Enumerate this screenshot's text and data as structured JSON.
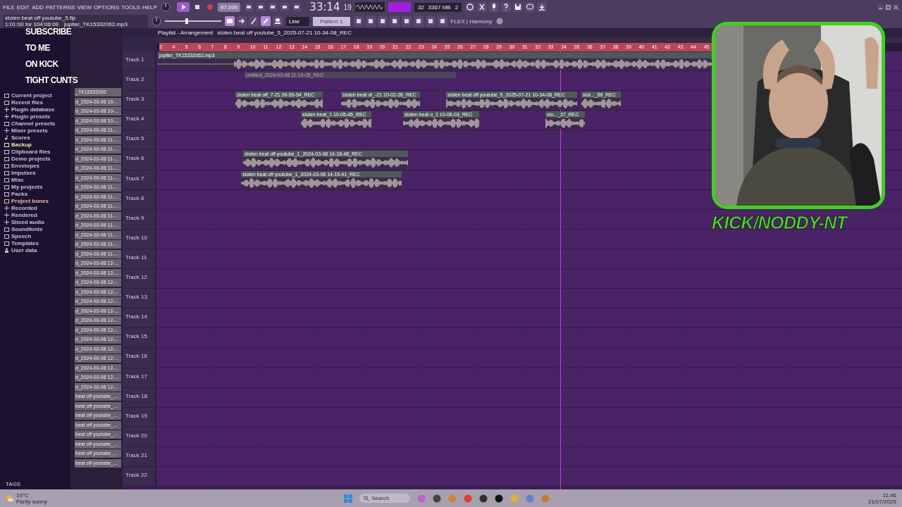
{
  "menu": [
    "FILE",
    "EDIT",
    "ADD",
    "PATTERNS",
    "VIEW",
    "OPTIONS",
    "TOOLS",
    "HELP"
  ],
  "project": {
    "file": "stolen beat off youtube_5.flp",
    "position": "1:01:00 for 104:06:09",
    "sample": "jupiter_TK15332062.mp3"
  },
  "volume": {
    "level": 0.38
  },
  "tempo": "97.000",
  "clock": {
    "time": "33:14",
    "ticks": "19"
  },
  "cpu": {
    "polyphony": "32",
    "memory": "3367 MB",
    "count": "2"
  },
  "snap": "Line",
  "pattern": "Pattern 1",
  "hint": "FLEX | Harmony",
  "browser": {
    "items": [
      {
        "label": "Current project",
        "kind": "folder"
      },
      {
        "label": "Recent files",
        "kind": "folder"
      },
      {
        "label": "Plugin database",
        "kind": "plugin"
      },
      {
        "label": "Plugin presets",
        "kind": "plugin"
      },
      {
        "label": "Channel presets",
        "kind": "folder"
      },
      {
        "label": "Mixer presets",
        "kind": "plugin"
      },
      {
        "label": "Scores",
        "kind": "note"
      },
      {
        "label": "Backup",
        "kind": "highlight"
      },
      {
        "label": "Clipboard files",
        "kind": "folder"
      },
      {
        "label": "Demo projects",
        "kind": "folder"
      },
      {
        "label": "Envelopes",
        "kind": "folder"
      },
      {
        "label": "Impulses",
        "kind": "folder"
      },
      {
        "label": "Misc",
        "kind": "folder"
      },
      {
        "label": "My projects",
        "kind": "folder"
      },
      {
        "label": "Packs",
        "kind": "folder"
      },
      {
        "label": "Project bones",
        "kind": "bones"
      },
      {
        "label": "Recorded",
        "kind": "plugin"
      },
      {
        "label": "Rendered",
        "kind": "plugin"
      },
      {
        "label": "Sliced audio",
        "kind": "plugin"
      },
      {
        "label": "Soundfonts",
        "kind": "folder"
      },
      {
        "label": "Speech",
        "kind": "folder"
      },
      {
        "label": "Templates",
        "kind": "folder"
      },
      {
        "label": "User data",
        "kind": "user"
      }
    ],
    "tags": "TAGS"
  },
  "rack": [
    "_TK15332062",
    "d_2024-03-08 10-...",
    "d_2024-03-08 10-...",
    "d_2024-03-08 10-...",
    "d_2024-03-08 11-...",
    "d_2024-03-08 11-...",
    "d_2024-03-08 11-...",
    "d_2024-03-08 11-...",
    "d_2024-03-08 11-...",
    "d_2024-03-08 11-...",
    "d_2024-03-08 11-...",
    "d_2024-03-08 11-...",
    "d_2024-03-08 11-...",
    "d_2024-03-08 11-...",
    "d_2024-03-08 11-...",
    "d_2024-03-08 11-...",
    "d_2024-03-08 11-...",
    "d_2024-03-08 11-...",
    "d_2024-03-08 12-...",
    "d_2024-03-08 12-...",
    "d_2024-03-08 12-...",
    "d_2024-03-08 12-...",
    "d_2024-03-08 12-...",
    "d_2024-03-08 12-...",
    "d_2024-03-08 12-...",
    "d_2024-03-08 12-...",
    "d_2024-03-08 12-...",
    "d_2024-03-08 12-...",
    "d_2024-03-08 12-...",
    "d_2024-03-08 12-...",
    "d_2024-03-08 12-...",
    "d_2024-03-08 12-...",
    "beat off youtube_...",
    "beat off youtube_...",
    "beat off youtube_...",
    "beat off youtube_...",
    "beat off youtube_...",
    "beat off youtube_...",
    "beat off youtube_...",
    "beat off youtube_..."
  ],
  "playlist": {
    "title": "Playlist - Arrangement",
    "path": "stolen beat off youtube_5_2025-07-21 10-34-08_REC",
    "ruler": [
      "3",
      "4",
      "5",
      "6",
      "7",
      "8",
      "9",
      "10",
      "11",
      "12",
      "13",
      "14",
      "15",
      "16",
      "17",
      "18",
      "19",
      "20",
      "21",
      "22",
      "23",
      "24",
      "25",
      "26",
      "27",
      "28",
      "29",
      "30",
      "31",
      "32",
      "33",
      "34",
      "35",
      "36",
      "37",
      "38",
      "39",
      "40",
      "41",
      "42",
      "43",
      "44",
      "45"
    ],
    "tracks": [
      {
        "name": "Track 1",
        "clips": [
          {
            "label": "jupiter_TK15332062.mp3",
            "kind": "audio"
          }
        ]
      },
      {
        "name": "Track 2",
        "clips": [
          {
            "label": "untitled_2024-03-08 11-15-05_REC",
            "kind": "ghost"
          }
        ]
      },
      {
        "name": "Track 3",
        "clips": [
          {
            "label": "stolen beat off_7-21 09-59-54_REC",
            "kind": "audio"
          },
          {
            "label": "stolen beat of_-21 10-02-28_REC",
            "kind": "audio"
          },
          {
            "label": "stolen beat off youtube_5_2025-07-21 10-34-08_REC",
            "kind": "audio"
          },
          {
            "label": "stol..._58_REC",
            "kind": "audio"
          }
        ]
      },
      {
        "name": "Track 4",
        "clips": [
          {
            "label": "stolen beat_1 10-05-45_REC",
            "kind": "audio"
          },
          {
            "label": "stolen beat o_1 10-06-03_REC",
            "kind": "audio"
          },
          {
            "label": "sto..._37_REC",
            "kind": "audio"
          }
        ]
      },
      {
        "name": "Track 5"
      },
      {
        "name": "Track 6",
        "clips": [
          {
            "label": "stolen beat off youtube_1_2024-03-08 14-18-48_REC",
            "kind": "audio"
          }
        ]
      },
      {
        "name": "Track 7",
        "clips": [
          {
            "label": "stolen beat off youtube_1_2024-03-08 14-15-41_REC",
            "kind": "audio"
          }
        ]
      },
      {
        "name": "Track 8"
      },
      {
        "name": "Track 9"
      },
      {
        "name": "Track 10"
      },
      {
        "name": "Track 11"
      },
      {
        "name": "Track 12"
      },
      {
        "name": "Track 13"
      },
      {
        "name": "Track 14"
      },
      {
        "name": "Track 15"
      },
      {
        "name": "Track 16"
      },
      {
        "name": "Track 17"
      },
      {
        "name": "Track 18"
      },
      {
        "name": "Track 19"
      },
      {
        "name": "Track 20"
      },
      {
        "name": "Track 21"
      },
      {
        "name": "Track 22"
      }
    ]
  },
  "overlay": {
    "lines": [
      "SUBSCRIBE",
      "TO ME",
      "ON KICK",
      "TIGHT CUNTS"
    ],
    "handle": "KICK/NODDY-NT"
  },
  "taskbar": {
    "weather": {
      "temp": "19°C",
      "condition": "Partly sunny"
    },
    "search": "Search",
    "time": "11:46",
    "date": "21/07/2025"
  }
}
